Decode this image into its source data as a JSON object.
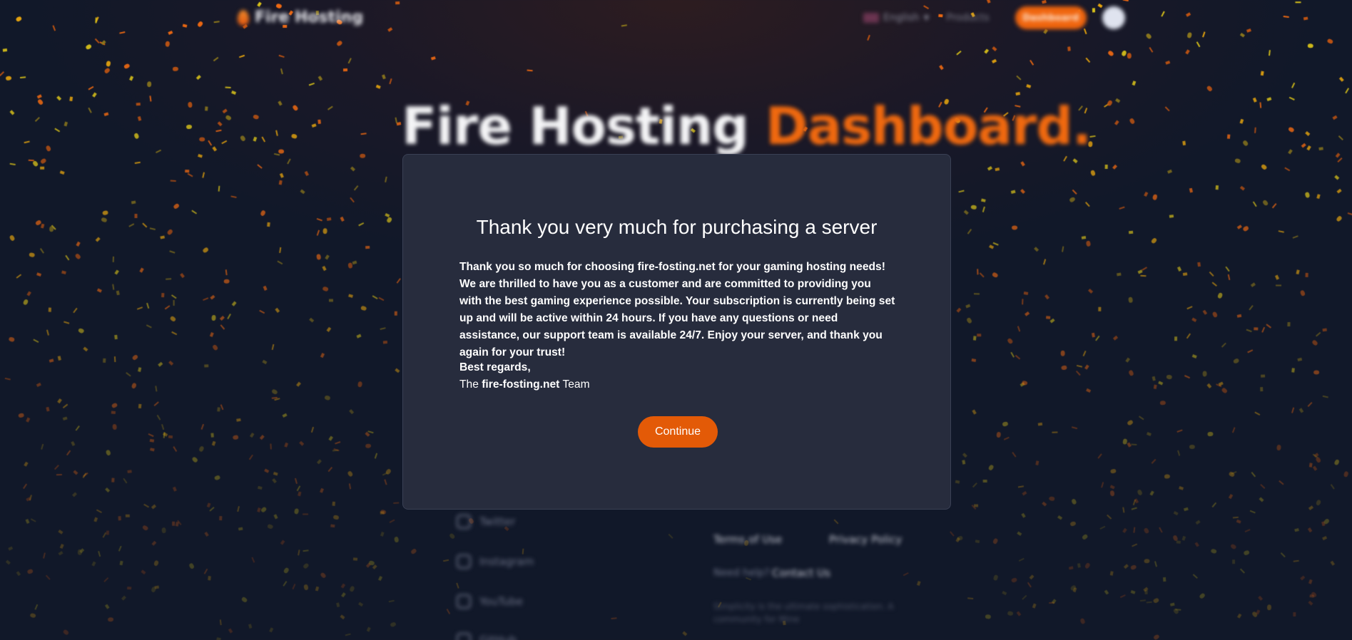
{
  "nav": {
    "brand": "Fire Hosting",
    "language": "English",
    "products": "Products",
    "dashboard_button": "Dashboard"
  },
  "hero": {
    "title_main": "Fire Hosting",
    "title_accent": "Dashboard."
  },
  "footer": {
    "socials": [
      "Twitter",
      "Instagram",
      "YouTube",
      "GitHub"
    ],
    "terms": "Terms of Use",
    "privacy": "Privacy Policy",
    "need_help": "Need help?",
    "contact": "Contact Us",
    "note": "Simplicity is the ultimate sophistication. A community for Mine"
  },
  "modal": {
    "title": "Thank you very much for purchasing a server",
    "body": "Thank you so much for choosing fire-fosting.net for your gaming hosting needs! We are thrilled to have you as a customer and are committed to providing you with the best gaming experience possible. Your subscription is currently being set up and will be active within 24 hours. If you have any questions or need assistance, our support team is available 24/7. Enjoy your server, and thank you again for your trust!",
    "regards": "Best regards,",
    "signoff_prefix": "The",
    "signoff_brand": "fire-fosting.net",
    "signoff_suffix": "Team",
    "continue_button": "Continue"
  },
  "colors": {
    "accent": "#e35a07",
    "modal_bg": "#272c3d",
    "page_bg": "#111829",
    "confetti": [
      "#f06a12",
      "#e8a60e",
      "#d9c21a",
      "#c25512",
      "#8f7a1c"
    ]
  }
}
